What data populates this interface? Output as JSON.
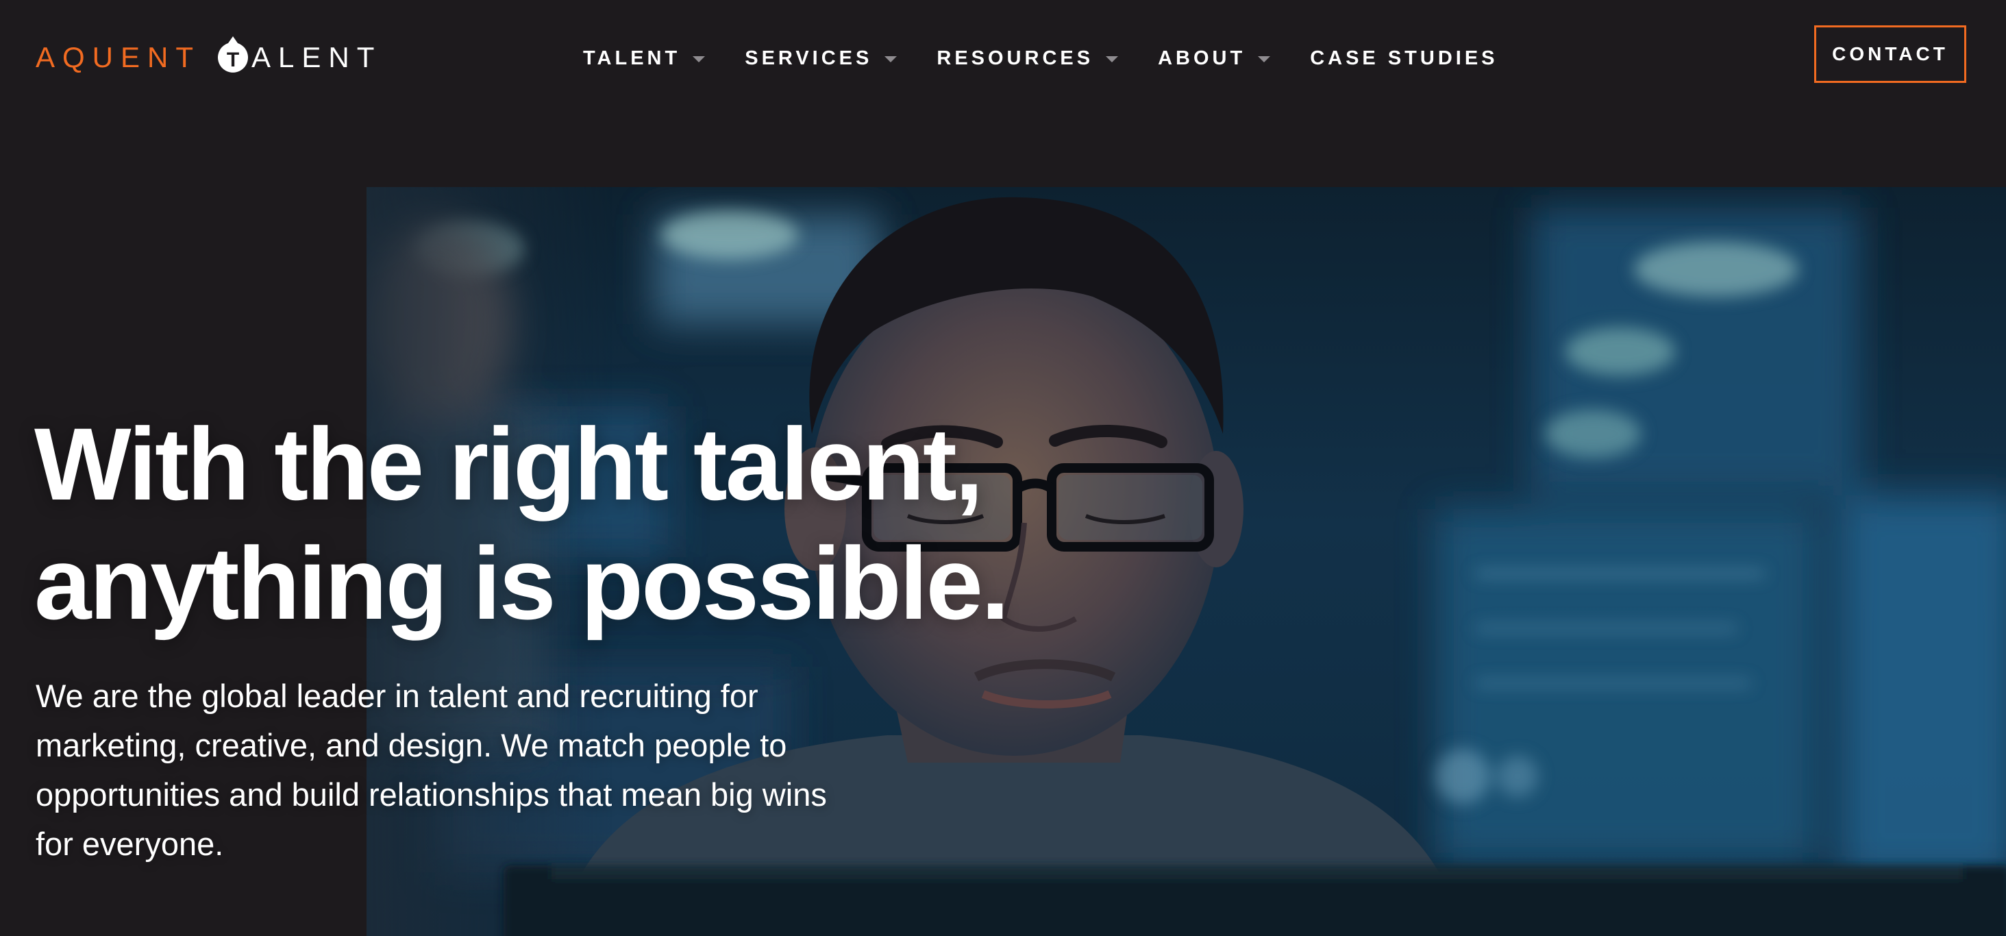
{
  "brand": {
    "name_part1": "AQUENT",
    "name_part2": "ALENT",
    "logo_letter": "T",
    "accent_color": "#f26b21",
    "background_color": "#1d1a1d"
  },
  "nav": {
    "items": [
      {
        "label": "TALENT",
        "has_dropdown": true
      },
      {
        "label": "SERVICES",
        "has_dropdown": true
      },
      {
        "label": "RESOURCES",
        "has_dropdown": true
      },
      {
        "label": "ABOUT",
        "has_dropdown": true
      },
      {
        "label": "CASE STUDIES",
        "has_dropdown": false
      }
    ],
    "contact_label": "CONTACT"
  },
  "hero": {
    "headline_line1": "With the right talent,",
    "headline_line2": "anything is possible.",
    "subtext_line1": "We are the global leader in talent and recruiting for",
    "subtext_line2": "marketing, creative, and design. We match people to",
    "subtext_line3": "opportunities and build relationships that mean big wins",
    "subtext_line4": "for everyone."
  }
}
